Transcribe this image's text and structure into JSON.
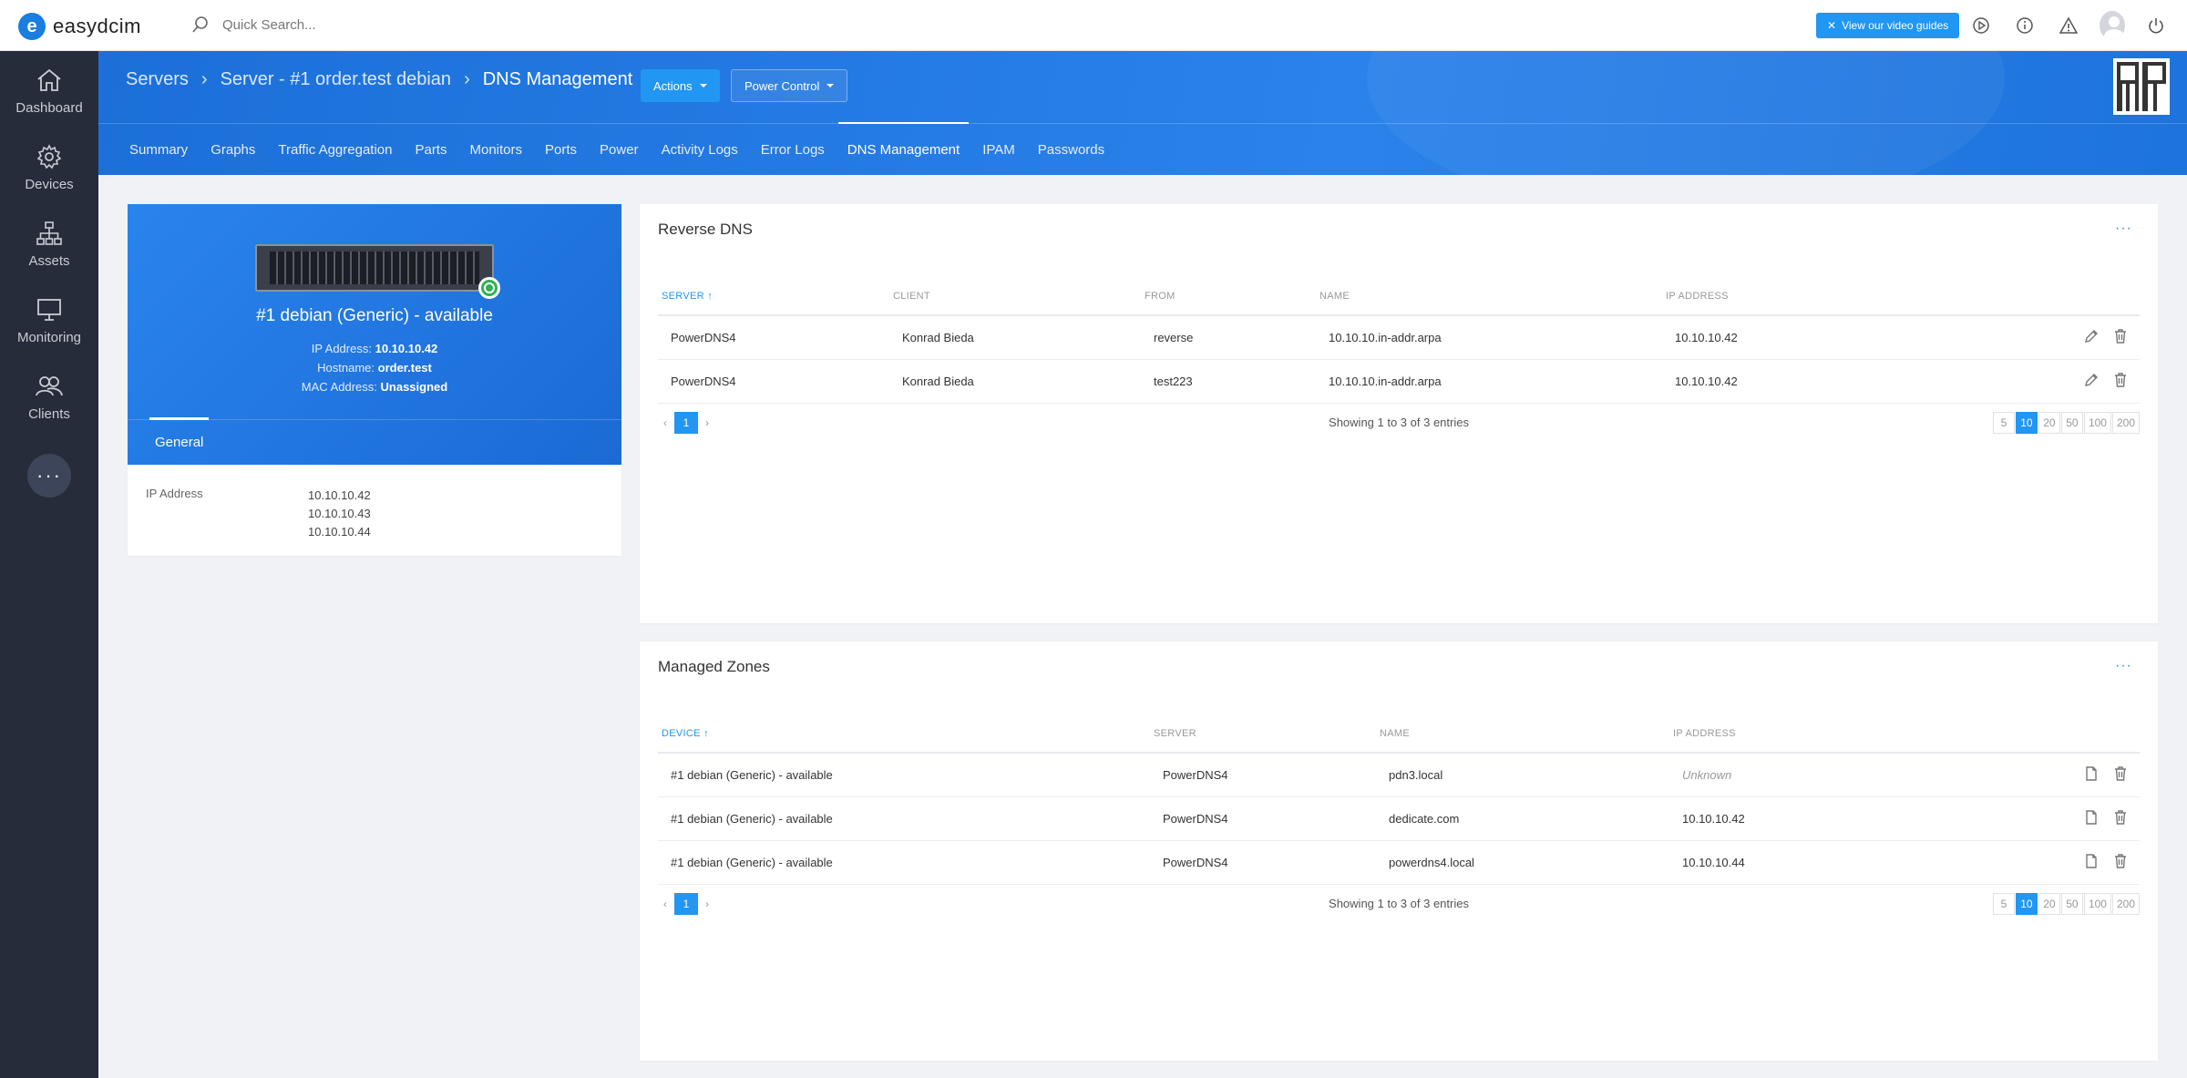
{
  "app": {
    "brand": "easydcim",
    "search_placeholder": "Quick Search..."
  },
  "topbar": {
    "video_label": "View our video guides",
    "colors": {
      "accent": "#2196f3",
      "brand": "#1a7de0"
    }
  },
  "sidebar": {
    "items": [
      {
        "label": "Dashboard",
        "icon": "home-icon"
      },
      {
        "label": "Devices",
        "icon": "gear-icon"
      },
      {
        "label": "Assets",
        "icon": "sitemap-icon"
      },
      {
        "label": "Monitoring",
        "icon": "monitor-icon"
      },
      {
        "label": "Clients",
        "icon": "users-icon"
      }
    ],
    "more": "···"
  },
  "header": {
    "breadcrumbs": [
      "Servers",
      "Server - #1 order.test debian",
      "DNS Management"
    ],
    "actions_label": "Actions",
    "power_label": "Power Control",
    "tabs": [
      "Summary",
      "Graphs",
      "Traffic Aggregation",
      "Parts",
      "Monitors",
      "Ports",
      "Power",
      "Activity Logs",
      "Error Logs",
      "DNS Management",
      "IPAM",
      "Passwords"
    ],
    "active_tab": "DNS Management"
  },
  "server": {
    "title": "#1 debian (Generic) - available",
    "ip_label": "IP Address:",
    "ip_value": "10.10.10.42",
    "hostname_label": "Hostname:",
    "hostname_value": "order.test",
    "mac_label": "MAC Address:",
    "mac_value": "Unassigned",
    "general_tab": "General",
    "ip_block_label": "IP Address",
    "ip_list": [
      "10.10.10.42",
      "10.10.10.43",
      "10.10.10.44"
    ]
  },
  "reverse_dns": {
    "title": "Reverse DNS",
    "columns": [
      "SERVER",
      "CLIENT",
      "FROM",
      "NAME",
      "IP ADDRESS"
    ],
    "rows": [
      [
        "PowerDNS4",
        "Konrad Bieda",
        "reverse",
        "10.10.10.in-addr.arpa",
        "10.10.10.42"
      ],
      [
        "PowerDNS4",
        "Konrad Bieda",
        "test223",
        "10.10.10.in-addr.arpa",
        "10.10.10.42"
      ]
    ],
    "page": "1",
    "showing": "Showing 1 to 3 of 3 entries",
    "sizes": [
      "5",
      "10",
      "20",
      "50",
      "100",
      "200"
    ],
    "active_size": "10"
  },
  "managed_zones": {
    "title": "Managed Zones",
    "columns": [
      "DEVICE",
      "SERVER",
      "NAME",
      "IP ADDRESS"
    ],
    "rows": [
      [
        "#1 debian (Generic) - available",
        "PowerDNS4",
        "pdn3.local",
        "Unknown"
      ],
      [
        "#1 debian (Generic) - available",
        "PowerDNS4",
        "dedicate.com",
        "10.10.10.42"
      ],
      [
        "#1 debian (Generic) - available",
        "PowerDNS4",
        "powerdns4.local",
        "10.10.10.44"
      ]
    ],
    "page": "1",
    "showing": "Showing 1 to 3 of 3 entries",
    "sizes": [
      "5",
      "10",
      "20",
      "50",
      "100",
      "200"
    ],
    "active_size": "10"
  }
}
